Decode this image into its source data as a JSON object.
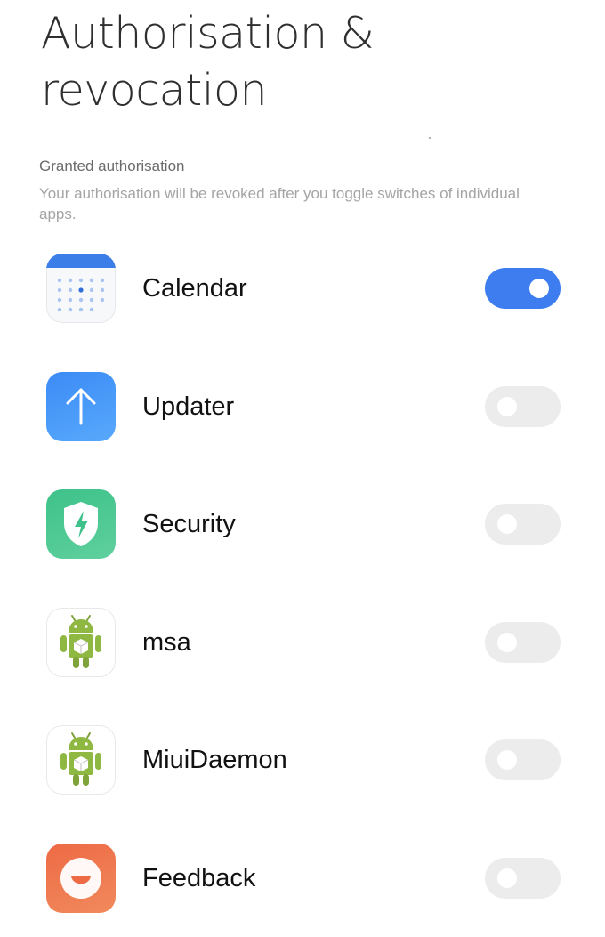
{
  "header": {
    "title": "Authorisation & revocation"
  },
  "section": {
    "title": "Granted authorisation",
    "description": "Your authorisation will be revoked after you toggle switches of individual apps."
  },
  "apps": [
    {
      "name": "Calendar",
      "icon": "calendar-icon",
      "enabled": true
    },
    {
      "name": "Updater",
      "icon": "updater-icon",
      "enabled": false
    },
    {
      "name": "Security",
      "icon": "security-icon",
      "enabled": false
    },
    {
      "name": "msa",
      "icon": "android-icon",
      "enabled": false
    },
    {
      "name": "MiuiDaemon",
      "icon": "android-icon",
      "enabled": false
    },
    {
      "name": "Feedback",
      "icon": "feedback-icon",
      "enabled": false
    }
  ],
  "colors": {
    "toggle_on": "#3d7df0",
    "toggle_off": "#ececec",
    "title_text": "#2f2f2f",
    "section_header": "#6b6b6b",
    "description_text": "#a4a4a4"
  }
}
